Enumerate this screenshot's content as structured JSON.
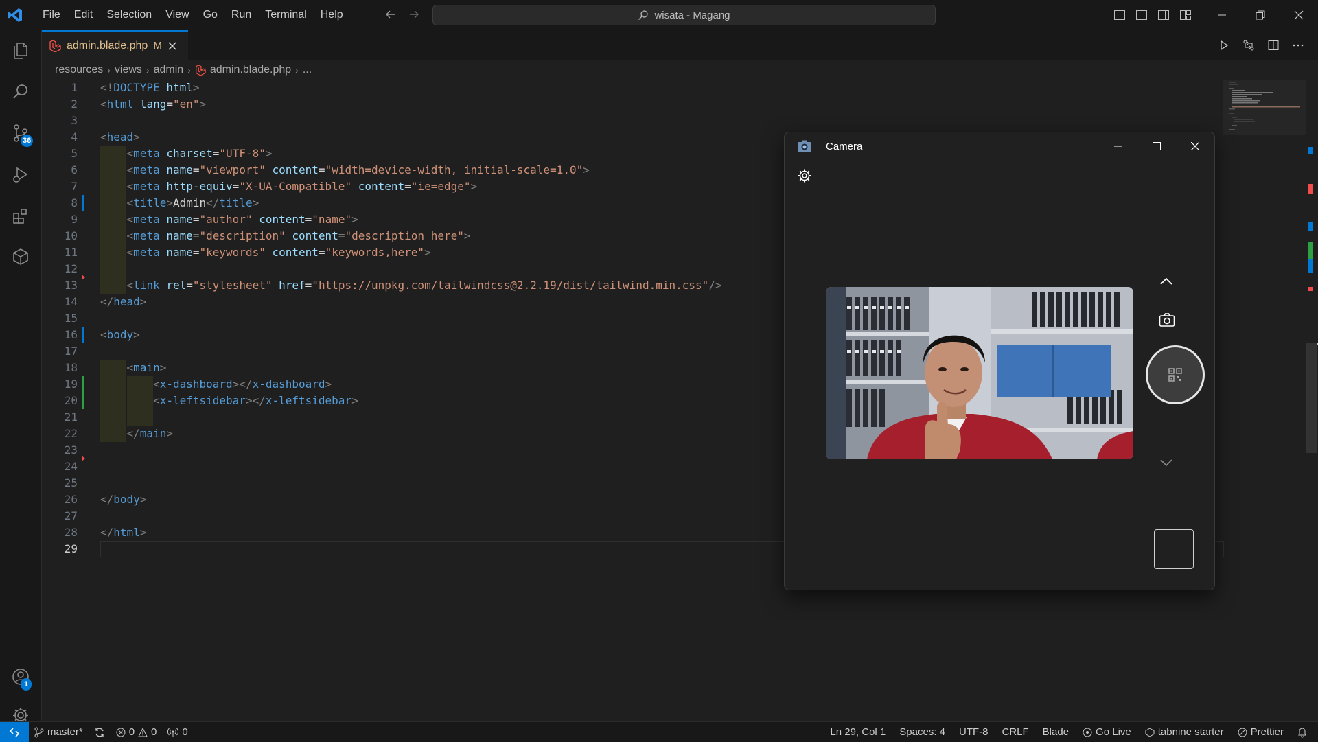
{
  "titlebar": {
    "menu": [
      "File",
      "Edit",
      "Selection",
      "View",
      "Go",
      "Run",
      "Terminal",
      "Help"
    ],
    "search_text": "wisata - Magang"
  },
  "activity": {
    "source_control_badge": "36",
    "accounts_badge": "1"
  },
  "tab": {
    "filename": "admin.blade.php",
    "modified": "M"
  },
  "breadcrumb": [
    "resources",
    "views",
    "admin",
    "admin.blade.php",
    "..."
  ],
  "editor": {
    "current_line": 29,
    "lines": [
      {
        "n": "1",
        "tokens": [
          [
            "punc",
            "<!"
          ],
          [
            "tag",
            "DOCTYPE"
          ],
          [
            "txt",
            " "
          ],
          [
            "attr",
            "html"
          ],
          [
            "punc",
            ">"
          ]
        ]
      },
      {
        "n": "2",
        "tokens": [
          [
            "punc",
            "<"
          ],
          [
            "tag",
            "html"
          ],
          [
            "txt",
            " "
          ],
          [
            "attr",
            "lang"
          ],
          [
            "txt",
            "="
          ],
          [
            "str",
            "\"en\""
          ],
          [
            "punc",
            ">"
          ]
        ]
      },
      {
        "n": "3",
        "tokens": []
      },
      {
        "n": "4",
        "tokens": [
          [
            "punc",
            "<"
          ],
          [
            "tag",
            "head"
          ],
          [
            "punc",
            ">"
          ]
        ]
      },
      {
        "n": "5",
        "tokens": [
          [
            "txt",
            "    "
          ],
          [
            "punc",
            "<"
          ],
          [
            "tag",
            "meta"
          ],
          [
            "txt",
            " "
          ],
          [
            "attr",
            "charset"
          ],
          [
            "txt",
            "="
          ],
          [
            "str",
            "\"UTF-8\""
          ],
          [
            "punc",
            ">"
          ]
        ]
      },
      {
        "n": "6",
        "tokens": [
          [
            "txt",
            "    "
          ],
          [
            "punc",
            "<"
          ],
          [
            "tag",
            "meta"
          ],
          [
            "txt",
            " "
          ],
          [
            "attr",
            "name"
          ],
          [
            "txt",
            "="
          ],
          [
            "str",
            "\"viewport\""
          ],
          [
            "txt",
            " "
          ],
          [
            "attr",
            "content"
          ],
          [
            "txt",
            "="
          ],
          [
            "str",
            "\"width=device-width, initial-scale=1.0\""
          ],
          [
            "punc",
            ">"
          ]
        ]
      },
      {
        "n": "7",
        "tokens": [
          [
            "txt",
            "    "
          ],
          [
            "punc",
            "<"
          ],
          [
            "tag",
            "meta"
          ],
          [
            "txt",
            " "
          ],
          [
            "attr",
            "http-equiv"
          ],
          [
            "txt",
            "="
          ],
          [
            "str",
            "\"X-UA-Compatible\""
          ],
          [
            "txt",
            " "
          ],
          [
            "attr",
            "content"
          ],
          [
            "txt",
            "="
          ],
          [
            "str",
            "\"ie=edge\""
          ],
          [
            "punc",
            ">"
          ]
        ]
      },
      {
        "n": "8",
        "tokens": [
          [
            "txt",
            "    "
          ],
          [
            "punc",
            "<"
          ],
          [
            "tag",
            "title"
          ],
          [
            "punc",
            ">"
          ],
          [
            "txt",
            "Admin"
          ],
          [
            "punc",
            "</"
          ],
          [
            "tag",
            "title"
          ],
          [
            "punc",
            ">"
          ]
        ]
      },
      {
        "n": "9",
        "tokens": [
          [
            "txt",
            "    "
          ],
          [
            "punc",
            "<"
          ],
          [
            "tag",
            "meta"
          ],
          [
            "txt",
            " "
          ],
          [
            "attr",
            "name"
          ],
          [
            "txt",
            "="
          ],
          [
            "str",
            "\"author\""
          ],
          [
            "txt",
            " "
          ],
          [
            "attr",
            "content"
          ],
          [
            "txt",
            "="
          ],
          [
            "str",
            "\"name\""
          ],
          [
            "punc",
            ">"
          ]
        ]
      },
      {
        "n": "10",
        "tokens": [
          [
            "txt",
            "    "
          ],
          [
            "punc",
            "<"
          ],
          [
            "tag",
            "meta"
          ],
          [
            "txt",
            " "
          ],
          [
            "attr",
            "name"
          ],
          [
            "txt",
            "="
          ],
          [
            "str",
            "\"description\""
          ],
          [
            "txt",
            " "
          ],
          [
            "attr",
            "content"
          ],
          [
            "txt",
            "="
          ],
          [
            "str",
            "\"description here\""
          ],
          [
            "punc",
            ">"
          ]
        ]
      },
      {
        "n": "11",
        "tokens": [
          [
            "txt",
            "    "
          ],
          [
            "punc",
            "<"
          ],
          [
            "tag",
            "meta"
          ],
          [
            "txt",
            " "
          ],
          [
            "attr",
            "name"
          ],
          [
            "txt",
            "="
          ],
          [
            "str",
            "\"keywords\""
          ],
          [
            "txt",
            " "
          ],
          [
            "attr",
            "content"
          ],
          [
            "txt",
            "="
          ],
          [
            "str",
            "\"keywords,here\""
          ],
          [
            "punc",
            ">"
          ]
        ]
      },
      {
        "n": "12",
        "tokens": []
      },
      {
        "n": "13",
        "tokens": [
          [
            "txt",
            "    "
          ],
          [
            "punc",
            "<"
          ],
          [
            "tag",
            "link"
          ],
          [
            "txt",
            " "
          ],
          [
            "attr",
            "rel"
          ],
          [
            "txt",
            "="
          ],
          [
            "str",
            "\"stylesheet\""
          ],
          [
            "txt",
            " "
          ],
          [
            "attr",
            "href"
          ],
          [
            "txt",
            "="
          ],
          [
            "str",
            "\""
          ],
          [
            "link",
            "https://unpkg.com/tailwindcss@2.2.19/dist/tailwind.min.css"
          ],
          [
            "str",
            "\""
          ],
          [
            "punc",
            "/>"
          ]
        ]
      },
      {
        "n": "14",
        "tokens": [
          [
            "punc",
            "</"
          ],
          [
            "tag",
            "head"
          ],
          [
            "punc",
            ">"
          ]
        ]
      },
      {
        "n": "15",
        "tokens": []
      },
      {
        "n": "16",
        "tokens": [
          [
            "punc",
            "<"
          ],
          [
            "tag",
            "body"
          ],
          [
            "punc",
            ">"
          ]
        ]
      },
      {
        "n": "17",
        "tokens": []
      },
      {
        "n": "18",
        "tokens": [
          [
            "txt",
            "    "
          ],
          [
            "punc",
            "<"
          ],
          [
            "tag",
            "main"
          ],
          [
            "punc",
            ">"
          ]
        ]
      },
      {
        "n": "19",
        "tokens": [
          [
            "txt",
            "        "
          ],
          [
            "punc",
            "<"
          ],
          [
            "tag",
            "x-dashboard"
          ],
          [
            "punc",
            "></"
          ],
          [
            "tag",
            "x-dashboard"
          ],
          [
            "punc",
            ">"
          ]
        ]
      },
      {
        "n": "20",
        "tokens": [
          [
            "txt",
            "        "
          ],
          [
            "punc",
            "<"
          ],
          [
            "tag",
            "x-leftsidebar"
          ],
          [
            "punc",
            "></"
          ],
          [
            "tag",
            "x-leftsidebar"
          ],
          [
            "punc",
            ">"
          ]
        ]
      },
      {
        "n": "21",
        "tokens": []
      },
      {
        "n": "22",
        "tokens": [
          [
            "txt",
            "    "
          ],
          [
            "punc",
            "</"
          ],
          [
            "tag",
            "main"
          ],
          [
            "punc",
            ">"
          ]
        ]
      },
      {
        "n": "23",
        "tokens": []
      },
      {
        "n": "24",
        "tokens": []
      },
      {
        "n": "25",
        "tokens": []
      },
      {
        "n": "26",
        "tokens": [
          [
            "punc",
            "</"
          ],
          [
            "tag",
            "body"
          ],
          [
            "punc",
            ">"
          ]
        ]
      },
      {
        "n": "27",
        "tokens": []
      },
      {
        "n": "28",
        "tokens": [
          [
            "punc",
            "</"
          ],
          [
            "tag",
            "html"
          ],
          [
            "punc",
            ">"
          ]
        ]
      },
      {
        "n": "29",
        "tokens": []
      }
    ]
  },
  "camera": {
    "title": "Camera"
  },
  "statusbar": {
    "branch": "master*",
    "errors": "0",
    "warnings": "0",
    "ports": "0",
    "position": "Ln 29, Col 1",
    "spaces": "Spaces: 4",
    "encoding": "UTF-8",
    "eol": "CRLF",
    "language": "Blade",
    "golive": "Go Live",
    "tabnine": "tabnine starter",
    "prettier": "Prettier"
  },
  "colors": {
    "accent": "#0078d4",
    "modified": "#e2c08d",
    "laravel": "#f55247"
  }
}
